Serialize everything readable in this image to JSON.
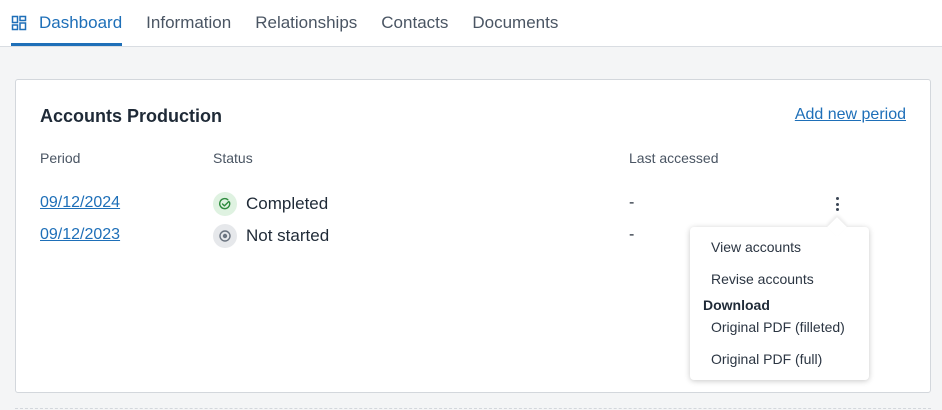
{
  "tabs": [
    {
      "label": "Dashboard",
      "icon": "dashboard-icon",
      "active": true
    },
    {
      "label": "Information"
    },
    {
      "label": "Relationships"
    },
    {
      "label": "Contacts"
    },
    {
      "label": "Documents"
    }
  ],
  "card": {
    "title": "Accounts Production",
    "add_link": "Add new period",
    "columns": {
      "period": "Period",
      "status": "Status",
      "last_accessed": "Last accessed"
    },
    "rows": [
      {
        "period": "09/12/2024",
        "status": "Completed",
        "status_icon": "check-circle-icon",
        "last_accessed": "-"
      },
      {
        "period": "09/12/2023",
        "status": "Not started",
        "status_icon": "dot-circle-icon",
        "last_accessed": "-"
      }
    ]
  },
  "menu": {
    "items": [
      "View accounts",
      "Revise accounts"
    ],
    "section_label": "Download",
    "download_items": [
      "Original PDF (filleted)",
      "Original PDF (full)"
    ]
  },
  "colors": {
    "accent": "#1e6fb8",
    "completed_bg": "#dff2e1",
    "completed_fg": "#2e8b3e",
    "not_started_bg": "#e6e8eb",
    "not_started_fg": "#6b7480"
  }
}
